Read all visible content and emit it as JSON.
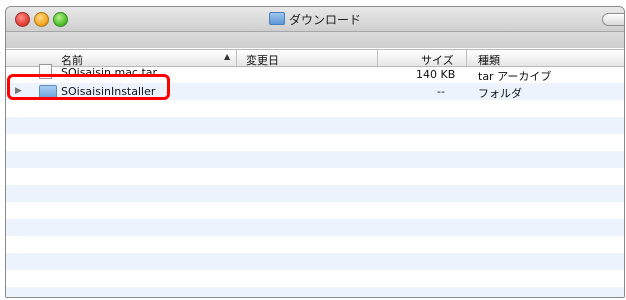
{
  "window": {
    "title": "ダウンロード",
    "folder_icon": "folder-icon"
  },
  "columns": {
    "name": "名前",
    "modified": "変更日",
    "size": "サイズ",
    "kind": "種類"
  },
  "files": [
    {
      "name": "SOisaisin.mac.tar",
      "modified": "",
      "size": "140 KB",
      "kind": "tar アーカイブ",
      "icon": "archive-file-icon"
    },
    {
      "name": "SOisaisinInstaller",
      "modified": "",
      "size": "--",
      "kind": "フォルダ",
      "icon": "folder-icon"
    }
  ],
  "annotation": {
    "color": "#ff0000",
    "target": "SOisaisinInstaller"
  }
}
